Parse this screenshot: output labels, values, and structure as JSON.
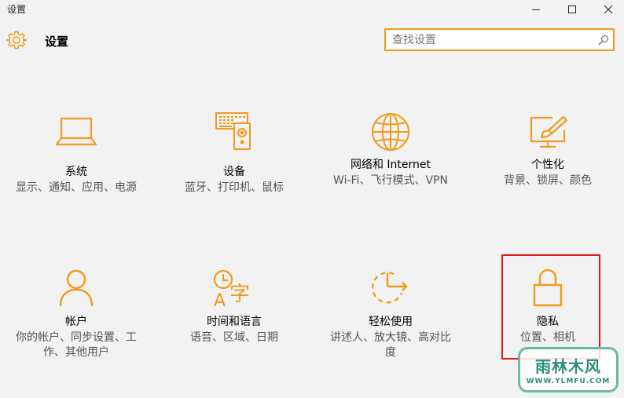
{
  "window": {
    "title": "设置"
  },
  "header": {
    "title": "设置"
  },
  "search": {
    "placeholder": "查找设置"
  },
  "tiles": [
    {
      "name": "系统",
      "desc": "显示、通知、应用、电源",
      "icon": "laptop-icon"
    },
    {
      "name": "设备",
      "desc": "蓝牙、打印机、鼠标",
      "icon": "devices-icon"
    },
    {
      "name": "网络和 Internet",
      "desc": "Wi-Fi、飞行模式、VPN",
      "icon": "globe-icon"
    },
    {
      "name": "个性化",
      "desc": "背景、锁屏、颜色",
      "icon": "paint-screen-icon"
    },
    {
      "name": "帐户",
      "desc": "你的帐户、同步设置、工作、其他用户",
      "icon": "person-icon"
    },
    {
      "name": "时间和语言",
      "desc": "语音、区域、日期",
      "icon": "time-language-icon"
    },
    {
      "name": "轻松使用",
      "desc": "讲述人、放大镜、高对比度",
      "icon": "ease-of-access-icon"
    },
    {
      "name": "隐私",
      "desc": "位置、相机",
      "icon": "lock-icon"
    }
  ],
  "watermark": {
    "line1": "雨林木风",
    "line2": "WWW.YLMFU.COM"
  },
  "colors": {
    "accent": "#f29a1d",
    "background": "#f2f2f2",
    "highlight": "#e01818",
    "watermark": "#2c8c7a"
  }
}
